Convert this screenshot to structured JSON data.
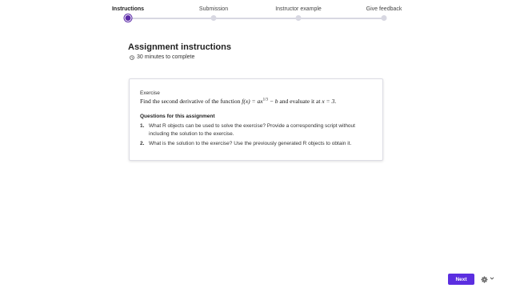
{
  "stepper": {
    "steps": [
      {
        "label": "Instructions",
        "active": true
      },
      {
        "label": "Submission",
        "active": false
      },
      {
        "label": "Instructor example",
        "active": false
      },
      {
        "label": "Give feedback",
        "active": false
      }
    ]
  },
  "header": {
    "title": "Assignment instructions",
    "duration": "30 minutes to complete",
    "duration_icon": "clock-icon"
  },
  "card": {
    "exercise_label": "Exercise",
    "exercise_prefix": "Find the second derivative of the function",
    "function_lhs": "f(x) = ax",
    "function_exp": "1/3",
    "function_rhs": " − b",
    "exercise_mid": "and evaluate it at",
    "eval_point": "x = 3",
    "exercise_end": ".",
    "questions_heading": "Questions for this assignment",
    "questions": [
      {
        "num": "1.",
        "text": "What R objects can be used to solve the exercise? Provide a corresponding script without including the solution to the exercise."
      },
      {
        "num": "2.",
        "text": "What is the solution to the exercise? Use the previously generated R objects to obtain it."
      }
    ]
  },
  "footer": {
    "next_label": "Next",
    "settings_icon": "gear-icon",
    "expand_icon": "chevron-down-icon"
  },
  "colors": {
    "accent": "#5b2aa8",
    "button": "#5b2ee0",
    "track": "#d8d8e2"
  }
}
